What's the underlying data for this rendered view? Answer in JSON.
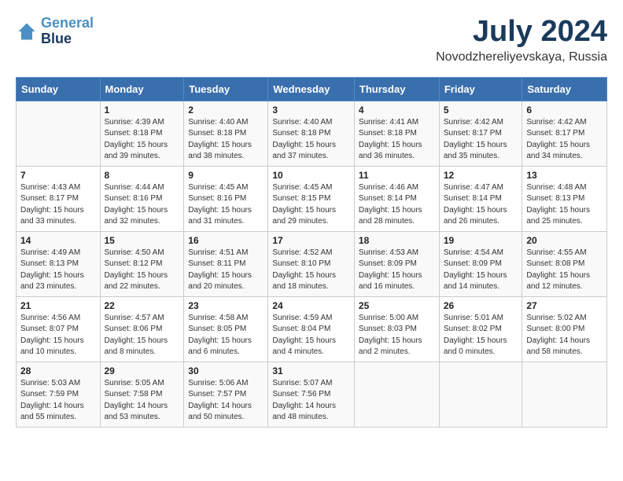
{
  "header": {
    "logo_line1": "General",
    "logo_line2": "Blue",
    "month_title": "July 2024",
    "location": "Novodzhereliyevskaya, Russia"
  },
  "columns": [
    "Sunday",
    "Monday",
    "Tuesday",
    "Wednesday",
    "Thursday",
    "Friday",
    "Saturday"
  ],
  "weeks": [
    [
      {
        "day": "",
        "sunrise": "",
        "sunset": "",
        "daylight": ""
      },
      {
        "day": "1",
        "sunrise": "Sunrise: 4:39 AM",
        "sunset": "Sunset: 8:18 PM",
        "daylight": "Daylight: 15 hours and 39 minutes."
      },
      {
        "day": "2",
        "sunrise": "Sunrise: 4:40 AM",
        "sunset": "Sunset: 8:18 PM",
        "daylight": "Daylight: 15 hours and 38 minutes."
      },
      {
        "day": "3",
        "sunrise": "Sunrise: 4:40 AM",
        "sunset": "Sunset: 8:18 PM",
        "daylight": "Daylight: 15 hours and 37 minutes."
      },
      {
        "day": "4",
        "sunrise": "Sunrise: 4:41 AM",
        "sunset": "Sunset: 8:18 PM",
        "daylight": "Daylight: 15 hours and 36 minutes."
      },
      {
        "day": "5",
        "sunrise": "Sunrise: 4:42 AM",
        "sunset": "Sunset: 8:17 PM",
        "daylight": "Daylight: 15 hours and 35 minutes."
      },
      {
        "day": "6",
        "sunrise": "Sunrise: 4:42 AM",
        "sunset": "Sunset: 8:17 PM",
        "daylight": "Daylight: 15 hours and 34 minutes."
      }
    ],
    [
      {
        "day": "7",
        "sunrise": "Sunrise: 4:43 AM",
        "sunset": "Sunset: 8:17 PM",
        "daylight": "Daylight: 15 hours and 33 minutes."
      },
      {
        "day": "8",
        "sunrise": "Sunrise: 4:44 AM",
        "sunset": "Sunset: 8:16 PM",
        "daylight": "Daylight: 15 hours and 32 minutes."
      },
      {
        "day": "9",
        "sunrise": "Sunrise: 4:45 AM",
        "sunset": "Sunset: 8:16 PM",
        "daylight": "Daylight: 15 hours and 31 minutes."
      },
      {
        "day": "10",
        "sunrise": "Sunrise: 4:45 AM",
        "sunset": "Sunset: 8:15 PM",
        "daylight": "Daylight: 15 hours and 29 minutes."
      },
      {
        "day": "11",
        "sunrise": "Sunrise: 4:46 AM",
        "sunset": "Sunset: 8:14 PM",
        "daylight": "Daylight: 15 hours and 28 minutes."
      },
      {
        "day": "12",
        "sunrise": "Sunrise: 4:47 AM",
        "sunset": "Sunset: 8:14 PM",
        "daylight": "Daylight: 15 hours and 26 minutes."
      },
      {
        "day": "13",
        "sunrise": "Sunrise: 4:48 AM",
        "sunset": "Sunset: 8:13 PM",
        "daylight": "Daylight: 15 hours and 25 minutes."
      }
    ],
    [
      {
        "day": "14",
        "sunrise": "Sunrise: 4:49 AM",
        "sunset": "Sunset: 8:13 PM",
        "daylight": "Daylight: 15 hours and 23 minutes."
      },
      {
        "day": "15",
        "sunrise": "Sunrise: 4:50 AM",
        "sunset": "Sunset: 8:12 PM",
        "daylight": "Daylight: 15 hours and 22 minutes."
      },
      {
        "day": "16",
        "sunrise": "Sunrise: 4:51 AM",
        "sunset": "Sunset: 8:11 PM",
        "daylight": "Daylight: 15 hours and 20 minutes."
      },
      {
        "day": "17",
        "sunrise": "Sunrise: 4:52 AM",
        "sunset": "Sunset: 8:10 PM",
        "daylight": "Daylight: 15 hours and 18 minutes."
      },
      {
        "day": "18",
        "sunrise": "Sunrise: 4:53 AM",
        "sunset": "Sunset: 8:09 PM",
        "daylight": "Daylight: 15 hours and 16 minutes."
      },
      {
        "day": "19",
        "sunrise": "Sunrise: 4:54 AM",
        "sunset": "Sunset: 8:09 PM",
        "daylight": "Daylight: 15 hours and 14 minutes."
      },
      {
        "day": "20",
        "sunrise": "Sunrise: 4:55 AM",
        "sunset": "Sunset: 8:08 PM",
        "daylight": "Daylight: 15 hours and 12 minutes."
      }
    ],
    [
      {
        "day": "21",
        "sunrise": "Sunrise: 4:56 AM",
        "sunset": "Sunset: 8:07 PM",
        "daylight": "Daylight: 15 hours and 10 minutes."
      },
      {
        "day": "22",
        "sunrise": "Sunrise: 4:57 AM",
        "sunset": "Sunset: 8:06 PM",
        "daylight": "Daylight: 15 hours and 8 minutes."
      },
      {
        "day": "23",
        "sunrise": "Sunrise: 4:58 AM",
        "sunset": "Sunset: 8:05 PM",
        "daylight": "Daylight: 15 hours and 6 minutes."
      },
      {
        "day": "24",
        "sunrise": "Sunrise: 4:59 AM",
        "sunset": "Sunset: 8:04 PM",
        "daylight": "Daylight: 15 hours and 4 minutes."
      },
      {
        "day": "25",
        "sunrise": "Sunrise: 5:00 AM",
        "sunset": "Sunset: 8:03 PM",
        "daylight": "Daylight: 15 hours and 2 minutes."
      },
      {
        "day": "26",
        "sunrise": "Sunrise: 5:01 AM",
        "sunset": "Sunset: 8:02 PM",
        "daylight": "Daylight: 15 hours and 0 minutes."
      },
      {
        "day": "27",
        "sunrise": "Sunrise: 5:02 AM",
        "sunset": "Sunset: 8:00 PM",
        "daylight": "Daylight: 14 hours and 58 minutes."
      }
    ],
    [
      {
        "day": "28",
        "sunrise": "Sunrise: 5:03 AM",
        "sunset": "Sunset: 7:59 PM",
        "daylight": "Daylight: 14 hours and 55 minutes."
      },
      {
        "day": "29",
        "sunrise": "Sunrise: 5:05 AM",
        "sunset": "Sunset: 7:58 PM",
        "daylight": "Daylight: 14 hours and 53 minutes."
      },
      {
        "day": "30",
        "sunrise": "Sunrise: 5:06 AM",
        "sunset": "Sunset: 7:57 PM",
        "daylight": "Daylight: 14 hours and 50 minutes."
      },
      {
        "day": "31",
        "sunrise": "Sunrise: 5:07 AM",
        "sunset": "Sunset: 7:56 PM",
        "daylight": "Daylight: 14 hours and 48 minutes."
      },
      {
        "day": "",
        "sunrise": "",
        "sunset": "",
        "daylight": ""
      },
      {
        "day": "",
        "sunrise": "",
        "sunset": "",
        "daylight": ""
      },
      {
        "day": "",
        "sunrise": "",
        "sunset": "",
        "daylight": ""
      }
    ]
  ]
}
